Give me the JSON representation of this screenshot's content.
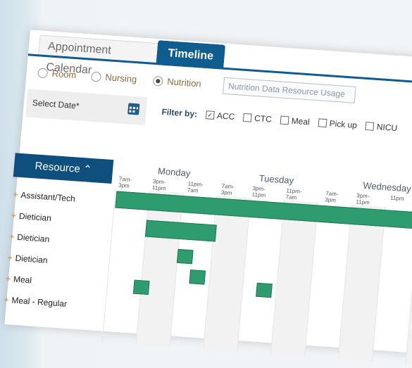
{
  "tabs": [
    {
      "label": "Appointment Calendar",
      "active": false
    },
    {
      "label": "Timeline",
      "active": true
    }
  ],
  "mode_radios": [
    {
      "label": "Room",
      "selected": false
    },
    {
      "label": "Nursing",
      "selected": false
    },
    {
      "label": "Nutrition",
      "selected": true
    }
  ],
  "usage_button_label": "Nutrition Data Resource Usage",
  "select_date_label": "Select Date*",
  "filter_by_label": "Filter by:",
  "filters": [
    {
      "label": "ACC",
      "checked": true
    },
    {
      "label": "CTC",
      "checked": false
    },
    {
      "label": "Meal",
      "checked": false
    },
    {
      "label": "Pick up",
      "checked": false
    },
    {
      "label": "NICU",
      "checked": false
    }
  ],
  "resource_header": "Resource",
  "resources": [
    "Assistant/Tech",
    "Dietician",
    "Dietician",
    "Dietician",
    "Meal",
    "Meal - Regular"
  ],
  "days": [
    {
      "name": "Monday",
      "shifts": [
        "7am-3pm",
        "3pm-11pm",
        "11pm-7am"
      ]
    },
    {
      "name": "Tuesday",
      "shifts": [
        "7am-3pm",
        "3pm-11pm",
        "11pm-7am"
      ]
    },
    {
      "name": "Wednesday",
      "shifts": [
        "7am-3pm",
        "3pm-11pm",
        "11pm"
      ]
    }
  ],
  "colors": {
    "brand": "#0f5c8e",
    "timeline_bar": "#2f9c6f",
    "accent": "#c89a35"
  }
}
